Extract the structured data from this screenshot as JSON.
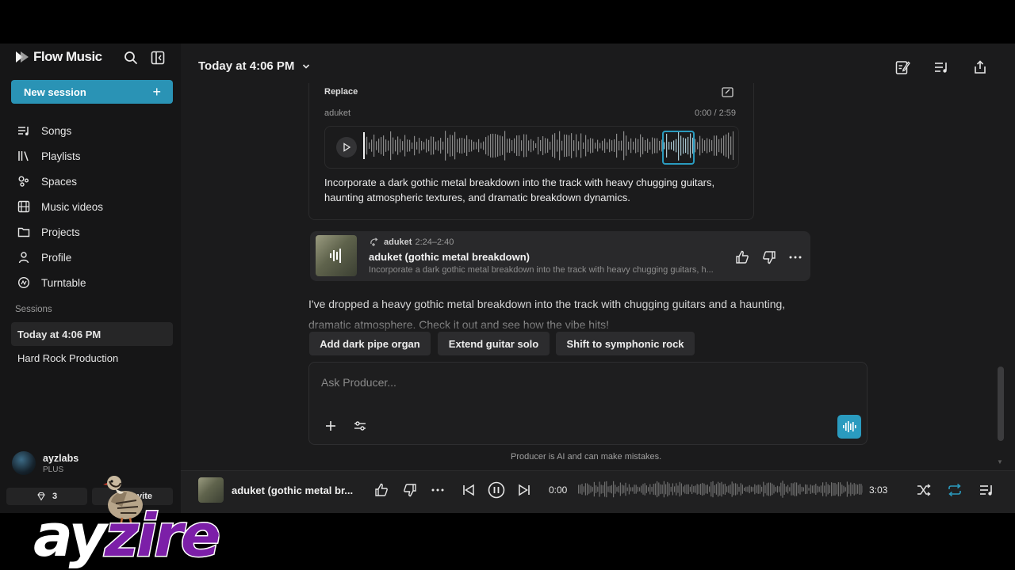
{
  "brand": {
    "name": "Flow Music"
  },
  "sidebar": {
    "new_session_label": "New session",
    "items": [
      {
        "label": "Songs",
        "icon": "songs-icon"
      },
      {
        "label": "Playlists",
        "icon": "playlists-icon"
      },
      {
        "label": "Spaces",
        "icon": "spaces-icon"
      },
      {
        "label": "Music videos",
        "icon": "video-icon"
      },
      {
        "label": "Projects",
        "icon": "folder-icon"
      },
      {
        "label": "Profile",
        "icon": "user-icon"
      },
      {
        "label": "Turntable",
        "icon": "turntable-icon"
      }
    ],
    "sessions_label": "Sessions",
    "sessions": [
      {
        "label": "Today at 4:06 PM",
        "active": true
      },
      {
        "label": "Hard Rock Production",
        "active": false
      }
    ],
    "user": {
      "name": "ayzlabs",
      "plan": "PLUS"
    },
    "credits": "3",
    "invite_label": "Invite"
  },
  "header": {
    "title": "Today at 4:06 PM"
  },
  "replace_card": {
    "label": "Replace",
    "artist": "aduket",
    "time": "0:00 / 2:59",
    "description": "Incorporate a dark gothic metal breakdown into the track with heavy chugging guitars, haunting atmospheric textures, and dramatic breakdown dynamics."
  },
  "result_card": {
    "artist": "aduket",
    "range": "2:24–2:40",
    "title": "aduket (gothic metal breakdown)",
    "description": "Incorporate a dark gothic metal breakdown into the track with heavy chugging guitars, h..."
  },
  "reply": "I've dropped a heavy gothic metal breakdown into the track with chugging guitars and a haunting, dramatic atmosphere. Check it out and see how the vibe hits!",
  "suggestions": [
    "Add dark pipe organ",
    "Extend guitar solo",
    "Shift to symphonic rock"
  ],
  "composer": {
    "placeholder": "Ask Producer..."
  },
  "disclaimer": "Producer is AI and can make mistakes.",
  "player": {
    "title": "aduket (gothic metal br...",
    "current_time": "0:00",
    "duration": "3:03"
  },
  "watermark": {
    "text": "ayzire",
    "registered": "®"
  },
  "colors": {
    "accent": "#2a9bbf",
    "background": "#1b1b1c",
    "sidebar": "#161617",
    "watermark_purple": "#7c1fa8"
  }
}
